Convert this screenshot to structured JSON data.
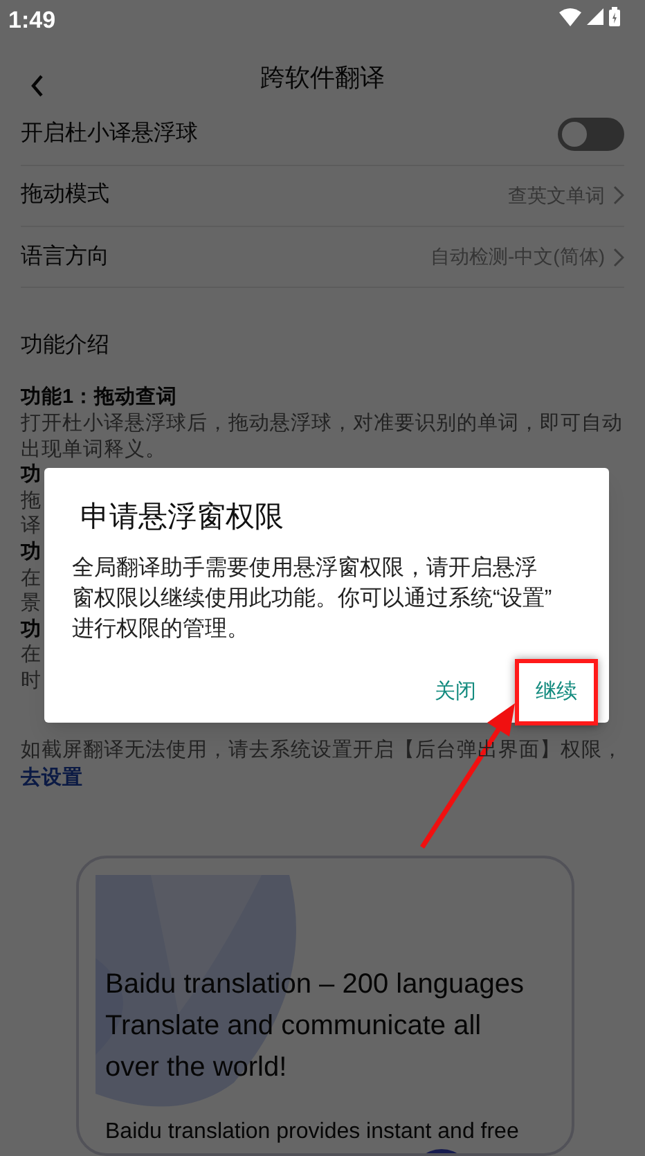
{
  "status_bar": {
    "time": "1:49"
  },
  "header": {
    "title": "跨软件翻译"
  },
  "settings": [
    {
      "kind": "toggle",
      "label": "开启杜小译悬浮球",
      "on": false
    },
    {
      "kind": "link",
      "label": "拖动模式",
      "value": "查英文单词"
    },
    {
      "kind": "link",
      "label": "语言方向",
      "value": "自动检测-中文(简体)"
    }
  ],
  "intro": {
    "heading": "功能介绍",
    "features": [
      {
        "title": "功能1：拖动查词",
        "lines": [
          "打开杜小译悬浮球后，拖动悬浮球，对准要识别的单词，即可自动",
          "出现单词释义。"
        ]
      },
      {
        "title": "功",
        "lines": [
          "拖",
          "译"
        ]
      },
      {
        "title": "功",
        "lines": [
          "在",
          "景"
        ]
      },
      {
        "title": "功",
        "lines": [
          "在",
          "时"
        ]
      }
    ],
    "note": "如截屏翻译无法使用，请去系统设置开启【后台弹出界面】权限，",
    "note_link": "去设置"
  },
  "card": {
    "headline_lines": [
      "Baidu translation – 200 languages",
      "Translate and communicate all",
      "over the world!"
    ],
    "body": "Baidu translation provides instant and free"
  },
  "dialog": {
    "title": "申请悬浮窗权限",
    "message_lines": [
      "全局翻译助手需要使用悬浮窗权限，请开启悬浮",
      "窗权限以继续使用此功能。你可以通过系统“设置”",
      "进行权限的管理。"
    ],
    "buttons": [
      {
        "label": "关闭",
        "highlighted": false
      },
      {
        "label": "继续",
        "highlighted": true
      }
    ]
  }
}
